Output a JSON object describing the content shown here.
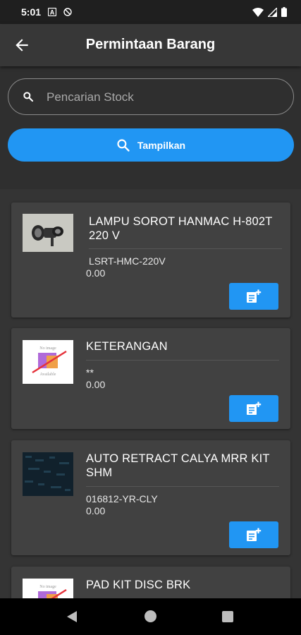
{
  "status_bar": {
    "time": "5:01",
    "icons": [
      "a-notification-icon",
      "blocked-icon",
      "wifi-icon",
      "signal-icon",
      "battery-icon"
    ]
  },
  "app_bar": {
    "title": "Permintaan Barang",
    "back_icon": "arrow-left-icon"
  },
  "search": {
    "placeholder": "Pencarian Stock",
    "value": "",
    "icon": "search-icon"
  },
  "show_button": {
    "label": "Tampilkan",
    "icon": "search-icon"
  },
  "items": [
    {
      "name": "LAMPU SOROT HANMAC H-802T 220 V",
      "code": "LSRT-HMC-220V",
      "price": "0.00",
      "image": "product-photo",
      "action_icon": "add-note-icon"
    },
    {
      "name": "KETERANGAN",
      "code": "**",
      "price": "0.00",
      "image": "no-image-placeholder",
      "action_icon": "add-note-icon"
    },
    {
      "name": "AUTO RETRACT CALYA MRR KIT SHM",
      "code": "016812-YR-CLY",
      "price": "0.00",
      "image": "product-photo",
      "action_icon": "add-note-icon"
    },
    {
      "name": "PAD KIT DISC BRK",
      "image": "no-image-placeholder"
    }
  ],
  "placeholder_image": {
    "line1": "No image",
    "line2": "Available"
  },
  "colors": {
    "accent": "#2196f3",
    "background": "#2f2f2f",
    "card": "#414141",
    "appbar": "#373737"
  }
}
